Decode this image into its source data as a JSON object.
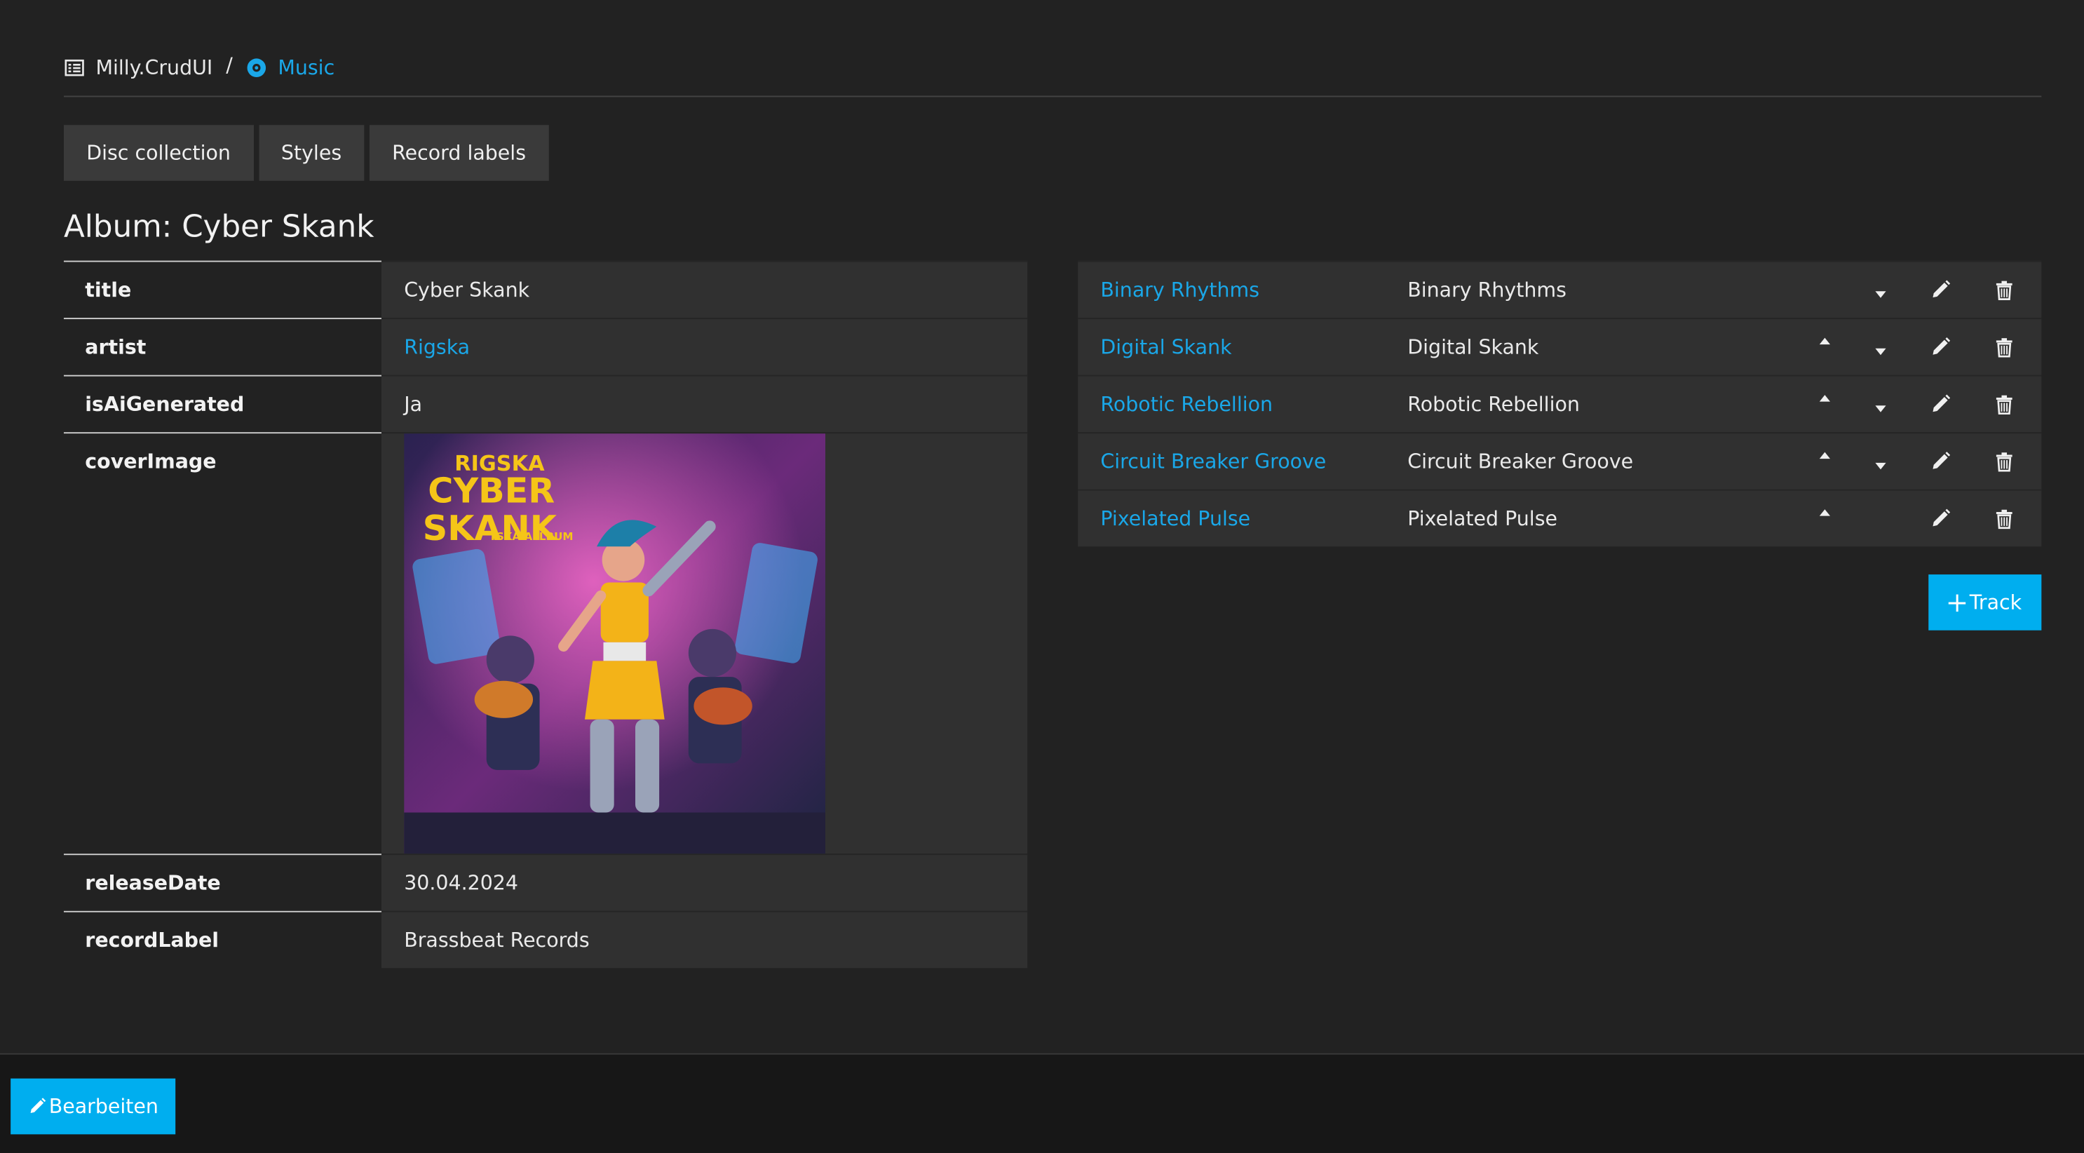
{
  "breadcrumb": {
    "root_icon": "list-icon",
    "root_label": "Milly.CrudUI",
    "separator": "/",
    "current_icon": "disc-icon",
    "current_label": "Music"
  },
  "tabs": [
    {
      "label": "Disc collection"
    },
    {
      "label": "Styles"
    },
    {
      "label": "Record labels"
    }
  ],
  "album": {
    "heading": "Album: Cyber Skank",
    "fields": {
      "title": {
        "key": "title",
        "value": "Cyber Skank"
      },
      "artist": {
        "key": "artist",
        "value": "Rigska"
      },
      "isAiGenerated": {
        "key": "isAiGenerated",
        "value": "Ja"
      },
      "coverImage": {
        "key": "coverImage",
        "art_text_1": "RIGSKA",
        "art_text_2": "CYBER",
        "art_text_3": "SKANK",
        "art_text_4": "TSKA ALLBUM"
      },
      "releaseDate": {
        "key": "releaseDate",
        "value": "30.04.2024"
      },
      "recordLabel": {
        "key": "recordLabel",
        "value": "Brassbeat Records"
      }
    }
  },
  "tracks": [
    {
      "link": "Binary Rhythms",
      "name": "Binary Rhythms",
      "up": false,
      "down": true
    },
    {
      "link": "Digital Skank",
      "name": "Digital Skank",
      "up": true,
      "down": true
    },
    {
      "link": "Robotic Rebellion",
      "name": "Robotic Rebellion",
      "up": true,
      "down": true
    },
    {
      "link": "Circuit Breaker Groove",
      "name": "Circuit Breaker Groove",
      "up": true,
      "down": true
    },
    {
      "link": "Pixelated Pulse",
      "name": "Pixelated Pulse",
      "up": true,
      "down": false
    }
  ],
  "actions": {
    "add_track_label": "Track",
    "add_track_icon": "plus-icon",
    "edit_label": "Bearbeiten",
    "edit_icon": "pencil-icon"
  },
  "colors": {
    "background": "#222222",
    "accent": "#00aeef",
    "link": "#1aa7e8",
    "panel": "#303030",
    "footer": "#171717"
  }
}
